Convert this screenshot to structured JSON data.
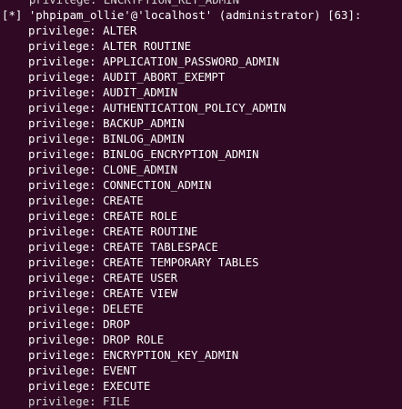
{
  "terminal": {
    "partial_top_line": "    privilege: ENCRYPTION_KEY_ADMIN",
    "header_line": "[*] 'phpipam_ollie'@'localhost' (administrator) [63]:",
    "privilege_prefix": "privilege: ",
    "privileges": [
      "ALTER",
      "ALTER ROUTINE",
      "APPLICATION_PASSWORD_ADMIN",
      "AUDIT_ABORT_EXEMPT",
      "AUDIT_ADMIN",
      "AUTHENTICATION_POLICY_ADMIN",
      "BACKUP_ADMIN",
      "BINLOG_ADMIN",
      "BINLOG_ENCRYPTION_ADMIN",
      "CLONE_ADMIN",
      "CONNECTION_ADMIN",
      "CREATE",
      "CREATE ROLE",
      "CREATE ROUTINE",
      "CREATE TABLESPACE",
      "CREATE TEMPORARY TABLES",
      "CREATE USER",
      "CREATE VIEW",
      "DELETE",
      "DROP",
      "DROP ROLE",
      "ENCRYPTION_KEY_ADMIN",
      "EVENT",
      "EXECUTE"
    ],
    "partial_bottom_line": "privilege: FILE"
  }
}
